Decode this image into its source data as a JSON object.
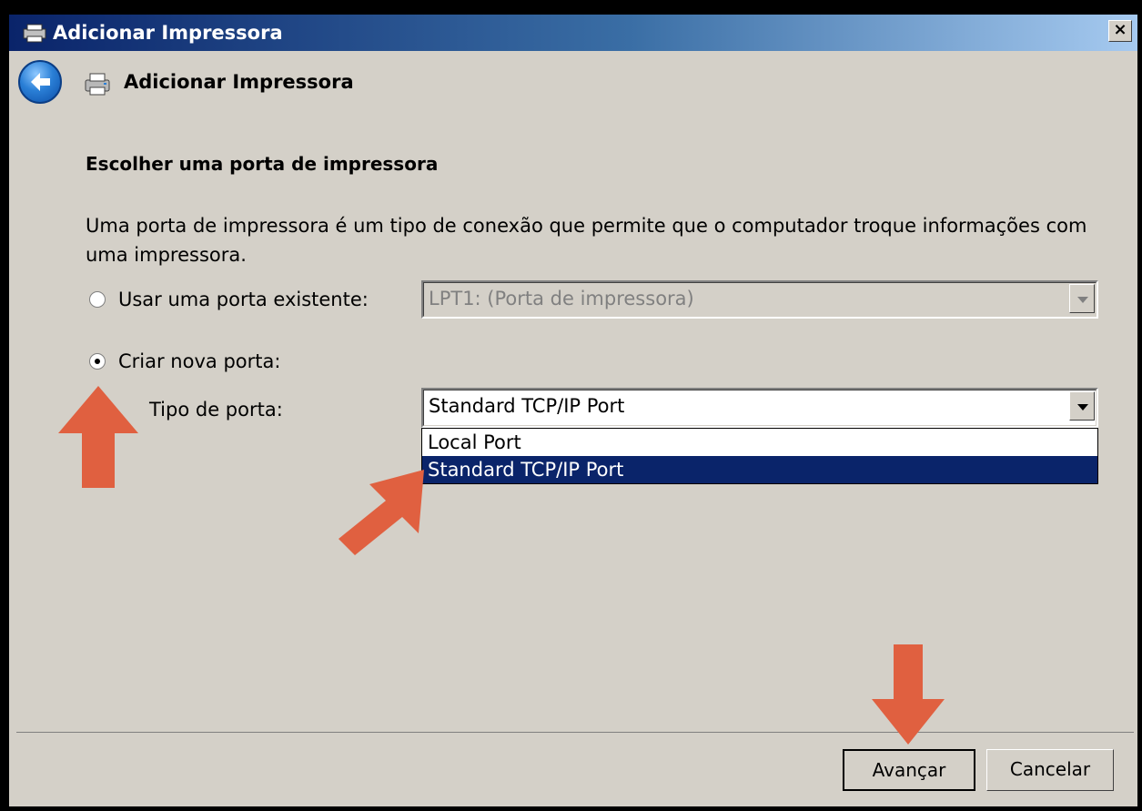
{
  "window": {
    "title": "Adicionar Impressora",
    "close_label": "×"
  },
  "nav": {
    "title": "Adicionar Impressora"
  },
  "main": {
    "heading": "Escolher uma porta de impressora",
    "description": "Uma porta de impressora é um tipo de conexão que permite que o computador troque informações com uma impressora.",
    "existing_port": {
      "label": "Usar uma porta existente:",
      "selected": false,
      "value": "LPT1: (Porta de impressora)"
    },
    "new_port": {
      "label": "Criar nova porta:",
      "selected": true
    },
    "port_type": {
      "label": "Tipo de porta:",
      "value": "Standard TCP/IP Port",
      "options": [
        "Local Port",
        "Standard TCP/IP Port"
      ],
      "highlighted": "Standard TCP/IP Port"
    }
  },
  "footer": {
    "next_label": "Avançar",
    "cancel_label": "Cancelar"
  },
  "colors": {
    "annotation_arrow": "#e06040",
    "selection": "#0a246a"
  },
  "icons": {
    "back": "back-arrow-icon",
    "printer": "printer-icon"
  }
}
